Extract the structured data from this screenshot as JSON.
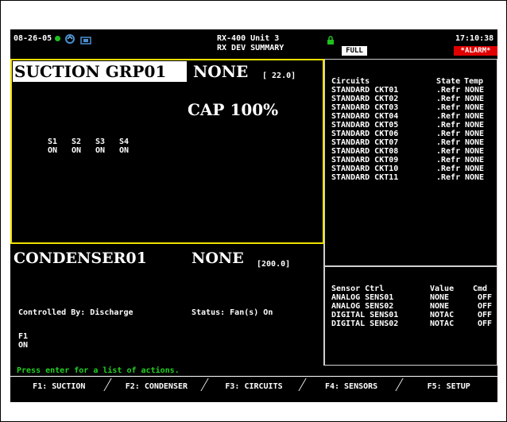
{
  "header": {
    "date": "08-26-05",
    "unit": "RX-400 Unit 3",
    "view": "RX DEV SUMMARY",
    "time": "17:10:38",
    "full_badge": "FULL",
    "alarm_badge": "*ALARM*"
  },
  "suction": {
    "title": "SUCTION GRP01",
    "state": "NONE",
    "setpoint": "[ 22.0]",
    "capacity": "CAP 100%",
    "stages": [
      {
        "label": "S1",
        "state": "ON"
      },
      {
        "label": "S2",
        "state": "ON"
      },
      {
        "label": "S3",
        "state": "ON"
      },
      {
        "label": "S4",
        "state": "ON"
      }
    ]
  },
  "circuits": {
    "headers": {
      "name": "Circuits",
      "state": "State",
      "temp": "Temp"
    },
    "rows": [
      {
        "name": "STANDARD CKT01",
        "state": ".Refr",
        "temp": "NONE"
      },
      {
        "name": "STANDARD CKT02",
        "state": ".Refr",
        "temp": "NONE"
      },
      {
        "name": "STANDARD CKT03",
        "state": ".Refr",
        "temp": "NONE"
      },
      {
        "name": "STANDARD CKT04",
        "state": ".Refr",
        "temp": "NONE"
      },
      {
        "name": "STANDARD CKT05",
        "state": ".Refr",
        "temp": "NONE"
      },
      {
        "name": "STANDARD CKT06",
        "state": ".Refr",
        "temp": "NONE"
      },
      {
        "name": "STANDARD CKT07",
        "state": ".Refr",
        "temp": "NONE"
      },
      {
        "name": "STANDARD CKT08",
        "state": ".Refr",
        "temp": "NONE"
      },
      {
        "name": "STANDARD CKT09",
        "state": ".Refr",
        "temp": "NONE"
      },
      {
        "name": "STANDARD CKT10",
        "state": ".Refr",
        "temp": "NONE"
      },
      {
        "name": "STANDARD CKT11",
        "state": ".Refr",
        "temp": "NONE"
      }
    ]
  },
  "condenser": {
    "title": "CONDENSER01",
    "state": "NONE",
    "setpoint": "[200.0]",
    "controlled_by": "Controlled By: Discharge",
    "status": "Status: Fan(s) On",
    "fan_label": "F1",
    "fan_state": "ON"
  },
  "sensors": {
    "headers": {
      "name": "Sensor Ctrl",
      "value": "Value",
      "cmd": "Cmd"
    },
    "rows": [
      {
        "name": "ANALOG SENS01",
        "value": "NONE",
        "cmd": "OFF"
      },
      {
        "name": "ANALOG SENS02",
        "value": "NONE",
        "cmd": "OFF"
      },
      {
        "name": "DIGITAL SENS01",
        "value": "NOTAC",
        "cmd": "OFF"
      },
      {
        "name": "DIGITAL SENS02",
        "value": "NOTAC",
        "cmd": "OFF"
      }
    ]
  },
  "status_line": "Press enter for a list of actions.",
  "function_keys": [
    {
      "label": "F1: SUCTION"
    },
    {
      "label": "F2: CONDENSER"
    },
    {
      "label": "F3: CIRCUITS"
    },
    {
      "label": "F4: SENSORS"
    },
    {
      "label": "F5: SETUP"
    }
  ],
  "colors": {
    "panel_border": "#f0e000",
    "status_text": "#22d022",
    "alarm": "#e00000"
  }
}
